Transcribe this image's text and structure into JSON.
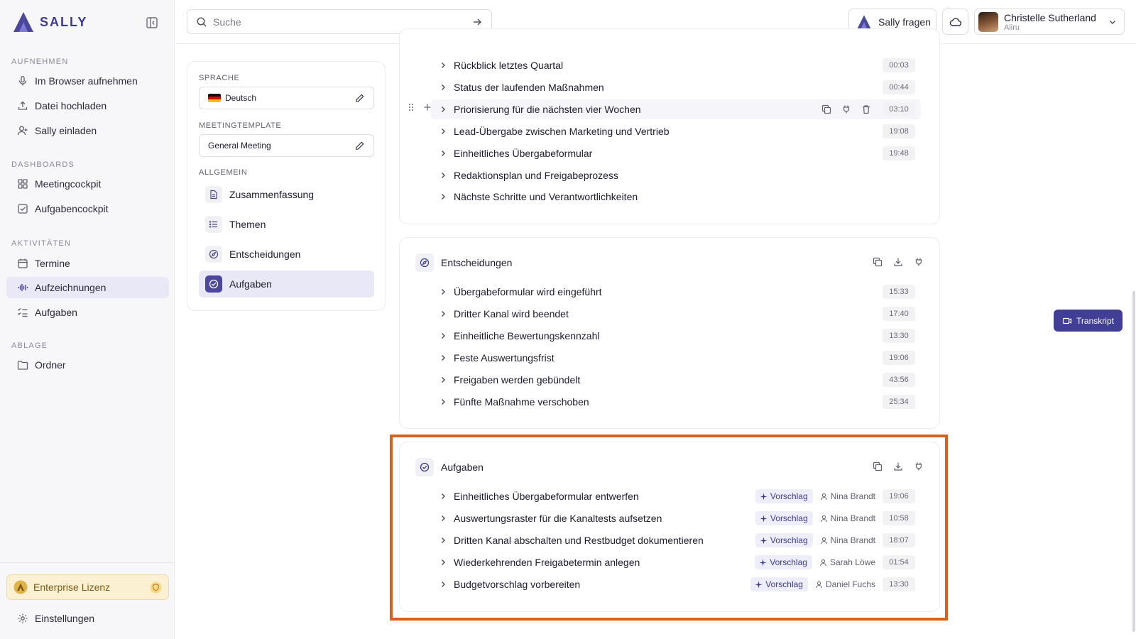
{
  "app": {
    "logo_text": "SALLY"
  },
  "sidebar": {
    "sections": [
      {
        "title": "AUFNEHMEN",
        "items": [
          {
            "label": "Im Browser aufnehmen",
            "icon": "microphone-icon"
          },
          {
            "label": "Datei hochladen",
            "icon": "upload-icon"
          },
          {
            "label": "Sally einladen",
            "icon": "user-plus-icon"
          }
        ]
      },
      {
        "title": "DASHBOARDS",
        "items": [
          {
            "label": "Meetingcockpit",
            "icon": "grid-icon"
          },
          {
            "label": "Aufgabencockpit",
            "icon": "checkbox-icon"
          }
        ]
      },
      {
        "title": "AKTIVITÄTEN",
        "items": [
          {
            "label": "Termine",
            "icon": "calendar-icon"
          },
          {
            "label": "Aufzeichnungen",
            "icon": "waveform-icon",
            "active": true
          },
          {
            "label": "Aufgaben",
            "icon": "checklist-icon"
          }
        ]
      },
      {
        "title": "ABLAGE",
        "items": [
          {
            "label": "Ordner",
            "icon": "folder-icon"
          }
        ]
      }
    ],
    "license_label": "Enterprise Lizenz",
    "settings_label": "Einstellungen"
  },
  "topbar": {
    "search_placeholder": "Suche",
    "ask_label": "Sally fragen",
    "user_name": "Christelle Sutherland",
    "user_org": "Aliru"
  },
  "settings_panel": {
    "language_label": "SPRACHE",
    "language_value": "Deutsch",
    "template_label": "MEETINGTEMPLATE",
    "template_value": "General Meeting",
    "general_label": "ALLGEMEIN",
    "items": [
      {
        "label": "Zusammenfassung",
        "icon": "document-icon"
      },
      {
        "label": "Themen",
        "icon": "list-icon"
      },
      {
        "label": "Entscheidungen",
        "icon": "compass-icon"
      },
      {
        "label": "Aufgaben",
        "icon": "check-circle-icon",
        "active": true
      }
    ]
  },
  "topics": {
    "rows": [
      {
        "title": "Rückblick letztes Quartal",
        "time": "00:03"
      },
      {
        "title": "Status der laufenden Maßnahmen",
        "time": "00:44"
      },
      {
        "title": "Priorisierung für die nächsten vier Wochen",
        "time": "03:10"
      },
      {
        "title": "Lead-Übergabe zwischen Marketing und Vertrieb",
        "time": "19:08"
      },
      {
        "title": "Einheitliches Übergabeformular",
        "time": "19:48"
      },
      {
        "title": "Redaktionsplan und Freigabeprozess",
        "time": ""
      },
      {
        "title": "Nächste Schritte und Verantwortlichkeiten",
        "time": ""
      }
    ]
  },
  "decisions": {
    "title": "Entscheidungen",
    "rows": [
      {
        "title": "Übergabeformular wird eingeführt",
        "time": "15:33"
      },
      {
        "title": "Dritter Kanal wird beendet",
        "time": "17:40"
      },
      {
        "title": "Einheitliche Bewertungskennzahl",
        "time": "13:30"
      },
      {
        "title": "Feste Auswertungsfrist",
        "time": "19:06"
      },
      {
        "title": "Freigaben werden gebündelt",
        "time": "43:56"
      },
      {
        "title": "Fünfte Maßnahme verschoben",
        "time": "25:34"
      }
    ]
  },
  "tasks": {
    "title": "Aufgaben",
    "tag_label": "Vorschlag",
    "rows": [
      {
        "title": "Einheitliches Übergabeformular entwerfen",
        "assignee": "Nina Brandt",
        "time": "19:06"
      },
      {
        "title": "Auswertungsraster für die Kanaltests aufsetzen",
        "assignee": "Nina Brandt",
        "time": "10:58"
      },
      {
        "title": "Dritten Kanal abschalten und Restbudget dokumentieren",
        "assignee": "Nina Brandt",
        "time": "18:07"
      },
      {
        "title": "Wiederkehrenden Freigabetermin anlegen",
        "assignee": "Sarah Löwe",
        "time": "01:54"
      },
      {
        "title": "Budgetvorschlag vorbereiten",
        "assignee": "Daniel Fuchs",
        "time": "13:30"
      }
    ]
  },
  "transcript_label": "Transkript",
  "colors": {
    "accent": "#413e96",
    "highlight": "#d9601a",
    "license_bg": "#fbf0d2"
  }
}
